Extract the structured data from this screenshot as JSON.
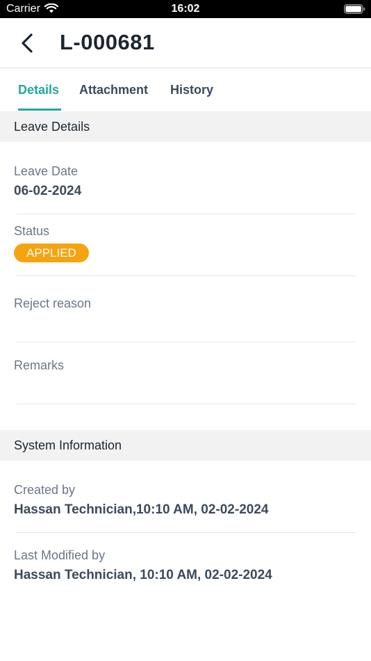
{
  "status_bar": {
    "carrier": "Carrier",
    "time": "16:02"
  },
  "header": {
    "title": "L-000681"
  },
  "tabs": [
    {
      "label": "Details",
      "active": true
    },
    {
      "label": "Attachment",
      "active": false
    },
    {
      "label": "History",
      "active": false
    }
  ],
  "leave_details": {
    "section_title": "Leave Details",
    "leave_date_label": "Leave Date",
    "leave_date_value": "06-02-2024",
    "status_label": "Status",
    "status_value": "APPLIED",
    "reject_reason_label": "Reject reason",
    "reject_reason_value": "",
    "remarks_label": "Remarks",
    "remarks_value": ""
  },
  "system_info": {
    "section_title": "System Information",
    "created_by_label": "Created by",
    "created_by_value": "Hassan Technician,10:10 AM, 02-02-2024",
    "last_modified_label": "Last Modified by",
    "last_modified_value": "Hassan Technician, 10:10 AM, 02-02-2024"
  },
  "colors": {
    "accent": "#1fa89a",
    "status_applied": "#f5a30f",
    "section_bg": "#f2f2f2"
  },
  "icons": {
    "back": "chevron-left-icon",
    "wifi": "wifi-icon",
    "battery": "battery-icon"
  }
}
